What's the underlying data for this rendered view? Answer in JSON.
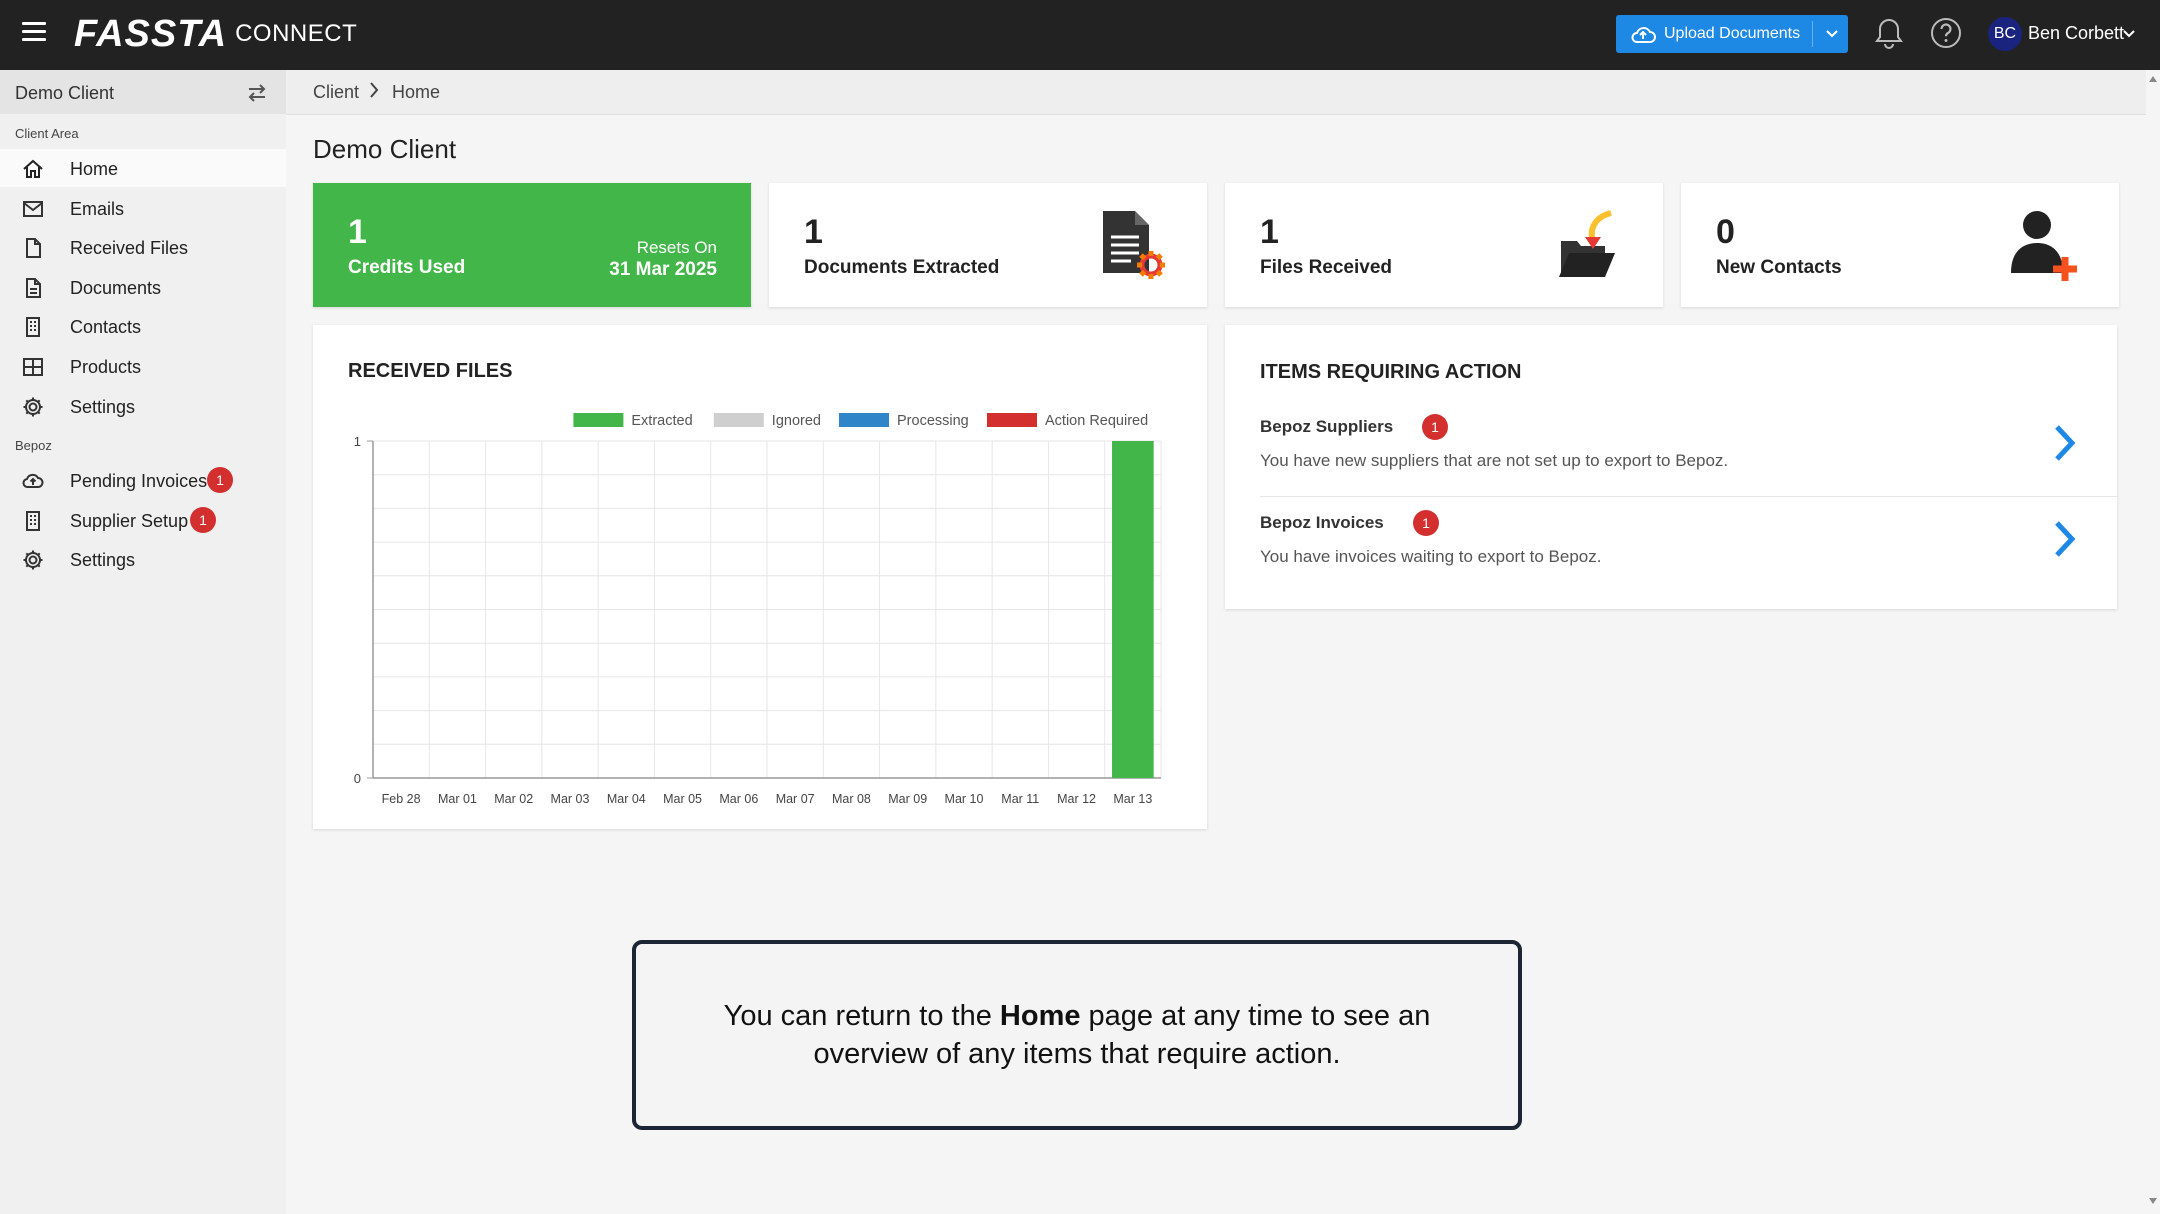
{
  "header": {
    "logo_main": "FASSTA",
    "logo_sub": "CONNECT",
    "upload_label": "Upload Documents",
    "user_initials": "BC",
    "user_name": "Ben Corbett"
  },
  "sidebar": {
    "client_name": "Demo Client",
    "sections": [
      {
        "label": "Client Area",
        "items": [
          {
            "label": "Home",
            "icon": "home-icon",
            "active": true
          },
          {
            "label": "Emails",
            "icon": "mail-icon"
          },
          {
            "label": "Received Files",
            "icon": "file-icon"
          },
          {
            "label": "Documents",
            "icon": "document-icon"
          },
          {
            "label": "Contacts",
            "icon": "building-icon"
          },
          {
            "label": "Products",
            "icon": "grid-icon"
          },
          {
            "label": "Settings",
            "icon": "gear-icon"
          }
        ]
      },
      {
        "label": "Bepoz",
        "items": [
          {
            "label": "Pending Invoices",
            "icon": "cloud-upload-icon",
            "badge": "1"
          },
          {
            "label": "Supplier Setup",
            "icon": "building-icon",
            "badge": "1"
          },
          {
            "label": "Settings",
            "icon": "gear-icon"
          }
        ]
      }
    ]
  },
  "breadcrumb": [
    "Client",
    "Home"
  ],
  "page_title": "Demo Client",
  "stats": [
    {
      "value": "1",
      "label": "Credits Used",
      "resets_label": "Resets On",
      "resets_date": "31 Mar 2025"
    },
    {
      "value": "1",
      "label": "Documents Extracted",
      "icon": "document-gear-icon"
    },
    {
      "value": "1",
      "label": "Files Received",
      "icon": "folder-arrow-icon"
    },
    {
      "value": "0",
      "label": "New Contacts",
      "icon": "user-add-icon"
    }
  ],
  "received_files": {
    "title": "RECEIVED FILES"
  },
  "chart_data": {
    "type": "bar",
    "categories": [
      "Feb 28",
      "Mar 01",
      "Mar 02",
      "Mar 03",
      "Mar 04",
      "Mar 05",
      "Mar 06",
      "Mar 07",
      "Mar 08",
      "Mar 09",
      "Mar 10",
      "Mar 11",
      "Mar 12",
      "Mar 13"
    ],
    "series": [
      {
        "name": "Extracted",
        "color": "#43b649",
        "values": [
          0,
          0,
          0,
          0,
          0,
          0,
          0,
          0,
          0,
          0,
          0,
          0,
          0,
          1
        ]
      },
      {
        "name": "Ignored",
        "color": "#cfcfcf",
        "values": [
          0,
          0,
          0,
          0,
          0,
          0,
          0,
          0,
          0,
          0,
          0,
          0,
          0,
          0
        ]
      },
      {
        "name": "Processing",
        "color": "#2e86c9",
        "values": [
          0,
          0,
          0,
          0,
          0,
          0,
          0,
          0,
          0,
          0,
          0,
          0,
          0,
          0
        ]
      },
      {
        "name": "Action Required",
        "color": "#d32f2f",
        "values": [
          0,
          0,
          0,
          0,
          0,
          0,
          0,
          0,
          0,
          0,
          0,
          0,
          0,
          0
        ]
      }
    ],
    "stacked": true,
    "ylim": [
      0,
      1
    ],
    "yticks": [
      "0",
      "1"
    ],
    "grid": true,
    "legend": "top-right"
  },
  "actions": {
    "title": "ITEMS REQUIRING ACTION",
    "items": [
      {
        "title": "Bepoz Suppliers",
        "badge": "1",
        "description": "You have new suppliers that are not set up to export to Bepoz."
      },
      {
        "title": "Bepoz Invoices",
        "badge": "1",
        "description": "You have invoices waiting to export to Bepoz."
      }
    ]
  },
  "tooltip": {
    "before": "You can return to the ",
    "bold": "Home",
    "after": " page at any time to see an overview of any items that require action."
  },
  "colors": {
    "topbar": "#222222",
    "accent": "#1e88e5",
    "success": "#43b649",
    "danger": "#d32f2f"
  }
}
